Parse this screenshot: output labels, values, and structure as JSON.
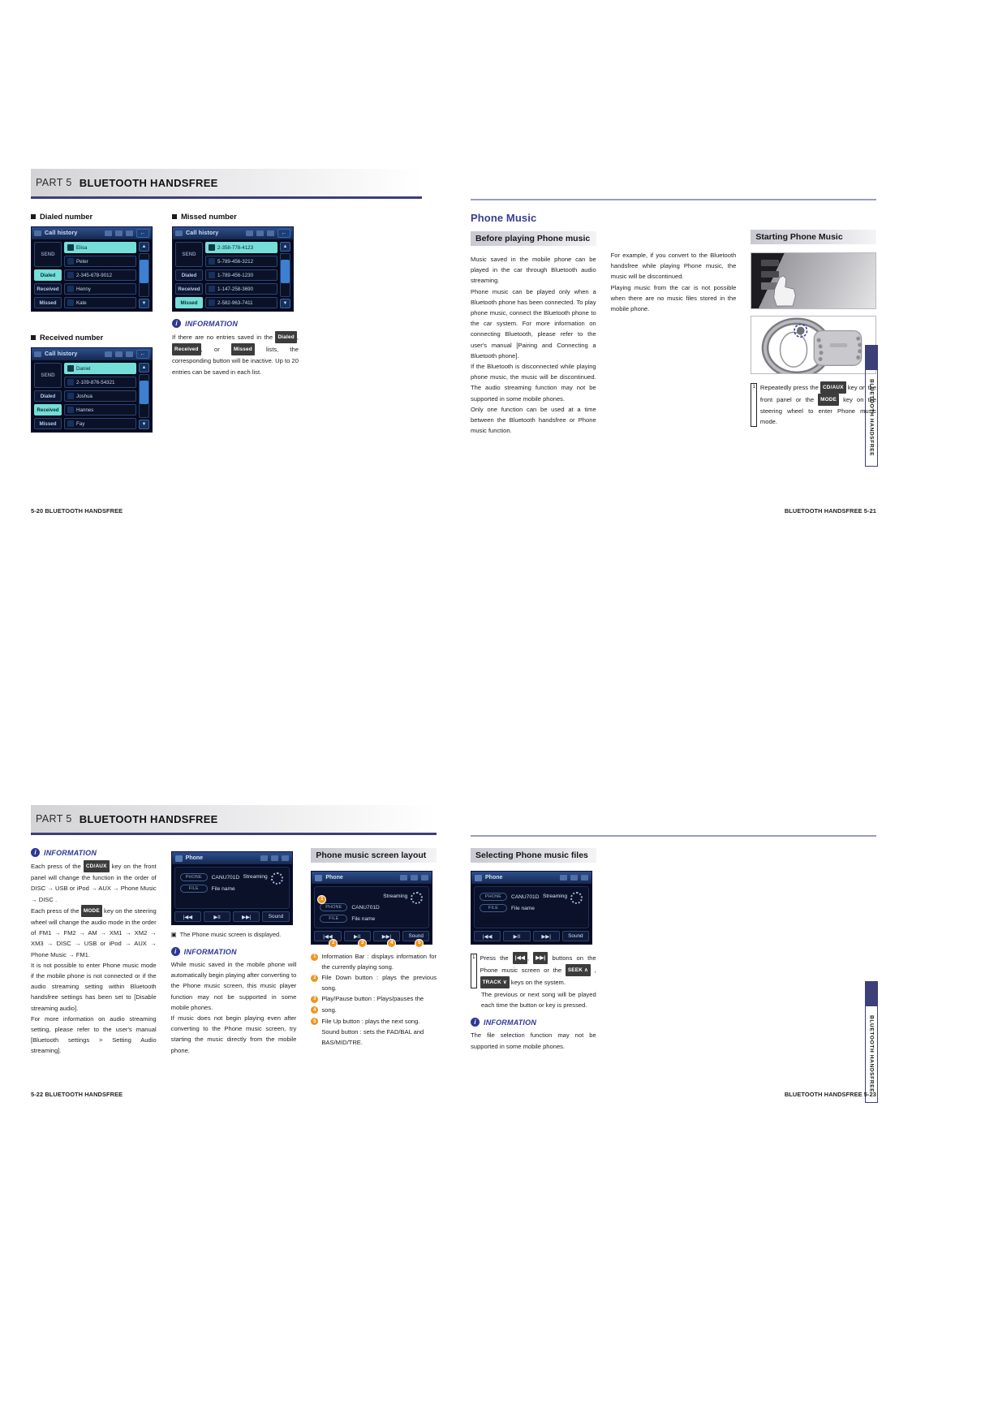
{
  "document": {
    "part_word": "PART 5",
    "part_title": "BLUETOOTH HANDSFREE"
  },
  "spread_a": {
    "page_left": {
      "footer": "5-20  BLUETOOTH HANDSFREE",
      "headings": {
        "dialed": "Dialed number",
        "missed": "Missed number",
        "received": "Received number"
      },
      "screens": {
        "dialed": {
          "title": "Call history",
          "send_label": "SEND",
          "tabs": [
            "Dialed",
            "Received",
            "Missed"
          ],
          "active_tab": "Dialed",
          "rows": [
            "Elisa",
            "Peter",
            "2-345-678-9012",
            "Henny",
            "Kate"
          ],
          "selected_row": "Elisa",
          "back_icon": "back-arrow-icon",
          "up_icon": "▲",
          "down_icon": "▼"
        },
        "missed": {
          "title": "Call history",
          "send_label": "SEND",
          "tabs": [
            "Dialed",
            "Received",
            "Missed"
          ],
          "active_tab": "Missed",
          "rows": [
            "2-358-778-4123",
            "5-789-456-3212",
            "1-789-456-1230",
            "1-147-258-3690",
            "2-582-963-7411"
          ],
          "selected_row": "2-358-778-4123",
          "up_icon": "▲",
          "down_icon": "▼"
        },
        "received": {
          "title": "Call history",
          "send_label": "SEND",
          "tabs": [
            "Dialed",
            "Received",
            "Missed"
          ],
          "active_tab": "Received",
          "rows": [
            "Daniel",
            "2-109-876-54321",
            "Joshua",
            "Hannes",
            "Fay"
          ],
          "selected_row": "Daniel",
          "up_icon": "▲",
          "down_icon": "▼"
        }
      },
      "information": {
        "label": "INFORMATION",
        "text_1": "If there are no entries saved in the ",
        "chip_1": "Dialed",
        "text_2": ", ",
        "chip_2": "Received",
        "text_3": ", or ",
        "chip_3": "Missed",
        "text_4": " lists, the corresponding button will be inactive. Up to 20 entries can be saved in each list."
      }
    },
    "page_right": {
      "footer": "BLUETOOTH HANDSFREE   5-21",
      "side_tab_text": "BLUETOOTH HANDSFREE",
      "title": "Phone Music",
      "sub_bar": "Before playing Phone music",
      "col1_paragraphs": [
        "Music saved in the mobile phone can be played in the car through Bluetooth audio streaming.",
        "Phone music can be played only when a Bluetooth phone has been connected. To play phone music, connect the Bluetooth phone to the car system. For more information on connecting Bluetooth, please refer to the user's manual [Pairing and Connecting a Bluetooth phone].",
        "If the Bluetooth is disconnected while playing phone music, the music will be discontinued. The audio streaming function may not be supported in some mobile phones.",
        "Only one function can be used at a time between the Bluetooth handsfree or Phone music function."
      ],
      "col2_paragraphs": [
        "For example, if you convert to the Bluetooth handsfree while playing Phone music, the music will be discontinued.",
        "Playing music from the car is not possible when there are no music files stored in the mobile phone."
      ],
      "col3": {
        "sub_bar": "Starting Phone Music",
        "photo_1": "front-panel-cd-aux-key-photo",
        "photo_2": "steering-wheel-mode-key-photo",
        "step_number": "1",
        "step_text_1": "Repeatedly press the ",
        "step_chip_1": "CD/AUX",
        "step_text_2": " key on the front panel or the ",
        "step_chip_2": "MODE",
        "step_text_3": " key on the steering wheel to enter Phone music mode."
      }
    }
  },
  "spread_b": {
    "page_left": {
      "footer": "5-22  BLUETOOTH HANDSFREE",
      "col1": {
        "info_label": "INFORMATION",
        "t1": "Each press of the ",
        "chip1": "CD/AUX",
        "t2": " key on the front panel will change the function in the order of DISC → USB or iPod → AUX → Phone Music → DISC .",
        "t3": "Each press of the ",
        "chip2": "MODE",
        "t4": " key on the steering wheel will change the audio mode in the order of FM1 → FM2 → AM → XM1 → XM2 → XM3 → DISC → USB or iPod → AUX → Phone Music → FM1.",
        "t5": "It is not possible to enter Phone music mode if the mobile phone is not connected or if the audio streaming setting within Bluetooth handsfree settings has been set to [Disable streaming audio].",
        "t6": "For more information on audio streaming setting, please refer to the user's manual [Bluetooth settings > Setting Audio streaming]."
      },
      "col2": {
        "screen": {
          "title": "Phone",
          "streaming_label": "Streaming",
          "pill_1": "PHONE",
          "value_1": "CANU701D",
          "pill_2": "FILE",
          "value_2": "File name",
          "keys": [
            "|◀◀",
            "▶II",
            "▶▶|",
            "Sound"
          ]
        },
        "caption": "The Phone music screen is displayed.",
        "info_label": "INFORMATION",
        "info_p1": "While music saved in the mobile phone will automatically begin playing after converting to the Phone music screen, this music player function may not be supported in some mobile phones.",
        "info_p2": "If music does not begin playing even after converting to the Phone music screen, try starting the music directly from the mobile phone."
      },
      "col3": {
        "sub_bar": "Phone music screen layout",
        "screen": {
          "title": "Phone",
          "streaming_label": "Streaming",
          "pill_1": "PHONE",
          "value_1": "CANU701D",
          "pill_2": "FILE",
          "value_2": "File name",
          "keys": [
            "|◀◀",
            "▶II",
            "▶▶|",
            "Sound"
          ]
        },
        "callouts": [
          {
            "n": "1",
            "text": "Information Bar : displays information for the currently playing song."
          },
          {
            "n": "2",
            "text": "File Down button : plays the previous song."
          },
          {
            "n": "3",
            "text": "Play/Pause button : Plays/pauses the"
          },
          {
            "n": "4",
            "text": "song."
          },
          {
            "n": "5",
            "text": "File Up button : plays the next song."
          }
        ],
        "callout_tail": "Sound button : sets the FAD/BAL and BAS/MID/TRE."
      }
    },
    "page_right": {
      "footer": "BLUETOOTH HANDSFREE   5-23",
      "side_tab_text": "BLUETOOTH HANDSFREE",
      "sub_bar": "Selecting Phone music files",
      "screen": {
        "title": "Phone",
        "streaming_label": "Streaming",
        "pill_1": "PHONE",
        "value_1": "CANU701D",
        "pill_2": "FILE",
        "value_2": "File name",
        "keys": [
          "|◀◀",
          "▶II",
          "▶▶|",
          "Sound"
        ]
      },
      "step_number": "1",
      "step_t1": "Press the ",
      "step_chip_a": "|◀◀",
      "step_t2": ", ",
      "step_chip_b": "▶▶|",
      "step_t3": " buttons on the Phone music screen or the ",
      "step_chip_c": "SEEK ∧",
      "step_t4": " , ",
      "step_chip_d": "TRACK ∨",
      "step_t5": " keys on the system.",
      "step_t6": "The previous or next song will be played each time the button or key is pressed.",
      "info_label": "INFORMATION",
      "info_text": "The file selection function may not be supported in some mobile phones."
    }
  }
}
